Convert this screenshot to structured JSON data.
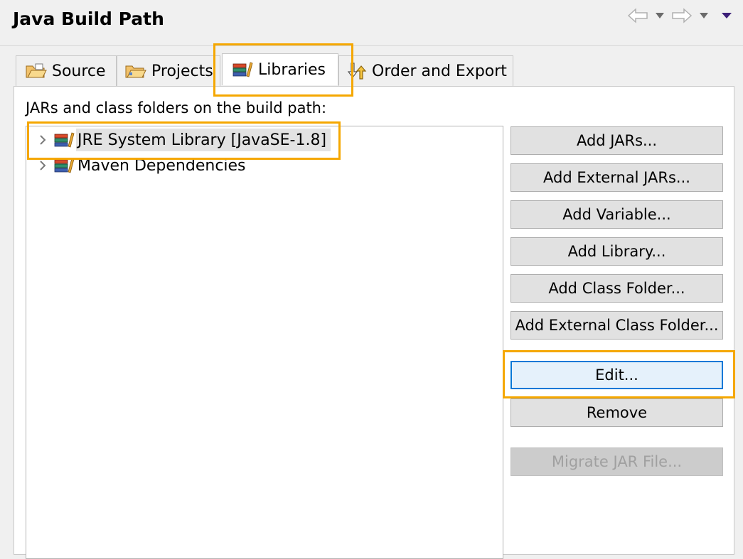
{
  "header": {
    "title": "Java Build Path"
  },
  "nav": {
    "back_icon": "back-arrow-icon",
    "forward_icon": "forward-arrow-icon",
    "menu_icon": "view-menu-icon"
  },
  "tabs": [
    {
      "label": "Source",
      "icon": "source-folder-icon"
    },
    {
      "label": "Projects",
      "icon": "projects-folder-icon"
    },
    {
      "label": "Libraries",
      "icon": "library-icon",
      "active": true
    },
    {
      "label": "Order and Export",
      "icon": "order-export-icon"
    }
  ],
  "libraries": {
    "description": "JARs and class folders on the build path:",
    "tree": [
      {
        "label": "JRE System Library [JavaSE-1.8]",
        "selected": true
      },
      {
        "label": "Maven Dependencies",
        "selected": false
      }
    ]
  },
  "buttons": {
    "add_jars": "Add JARs...",
    "add_external_jars": "Add External JARs...",
    "add_variable": "Add Variable...",
    "add_library": "Add Library...",
    "add_class_folder": "Add Class Folder...",
    "add_external_class_folder": "Add External Class Folder...",
    "edit": "Edit...",
    "remove": "Remove",
    "migrate_jar": "Migrate JAR File..."
  },
  "colors": {
    "highlight": "#f5a700",
    "focus": "#0078d7"
  }
}
